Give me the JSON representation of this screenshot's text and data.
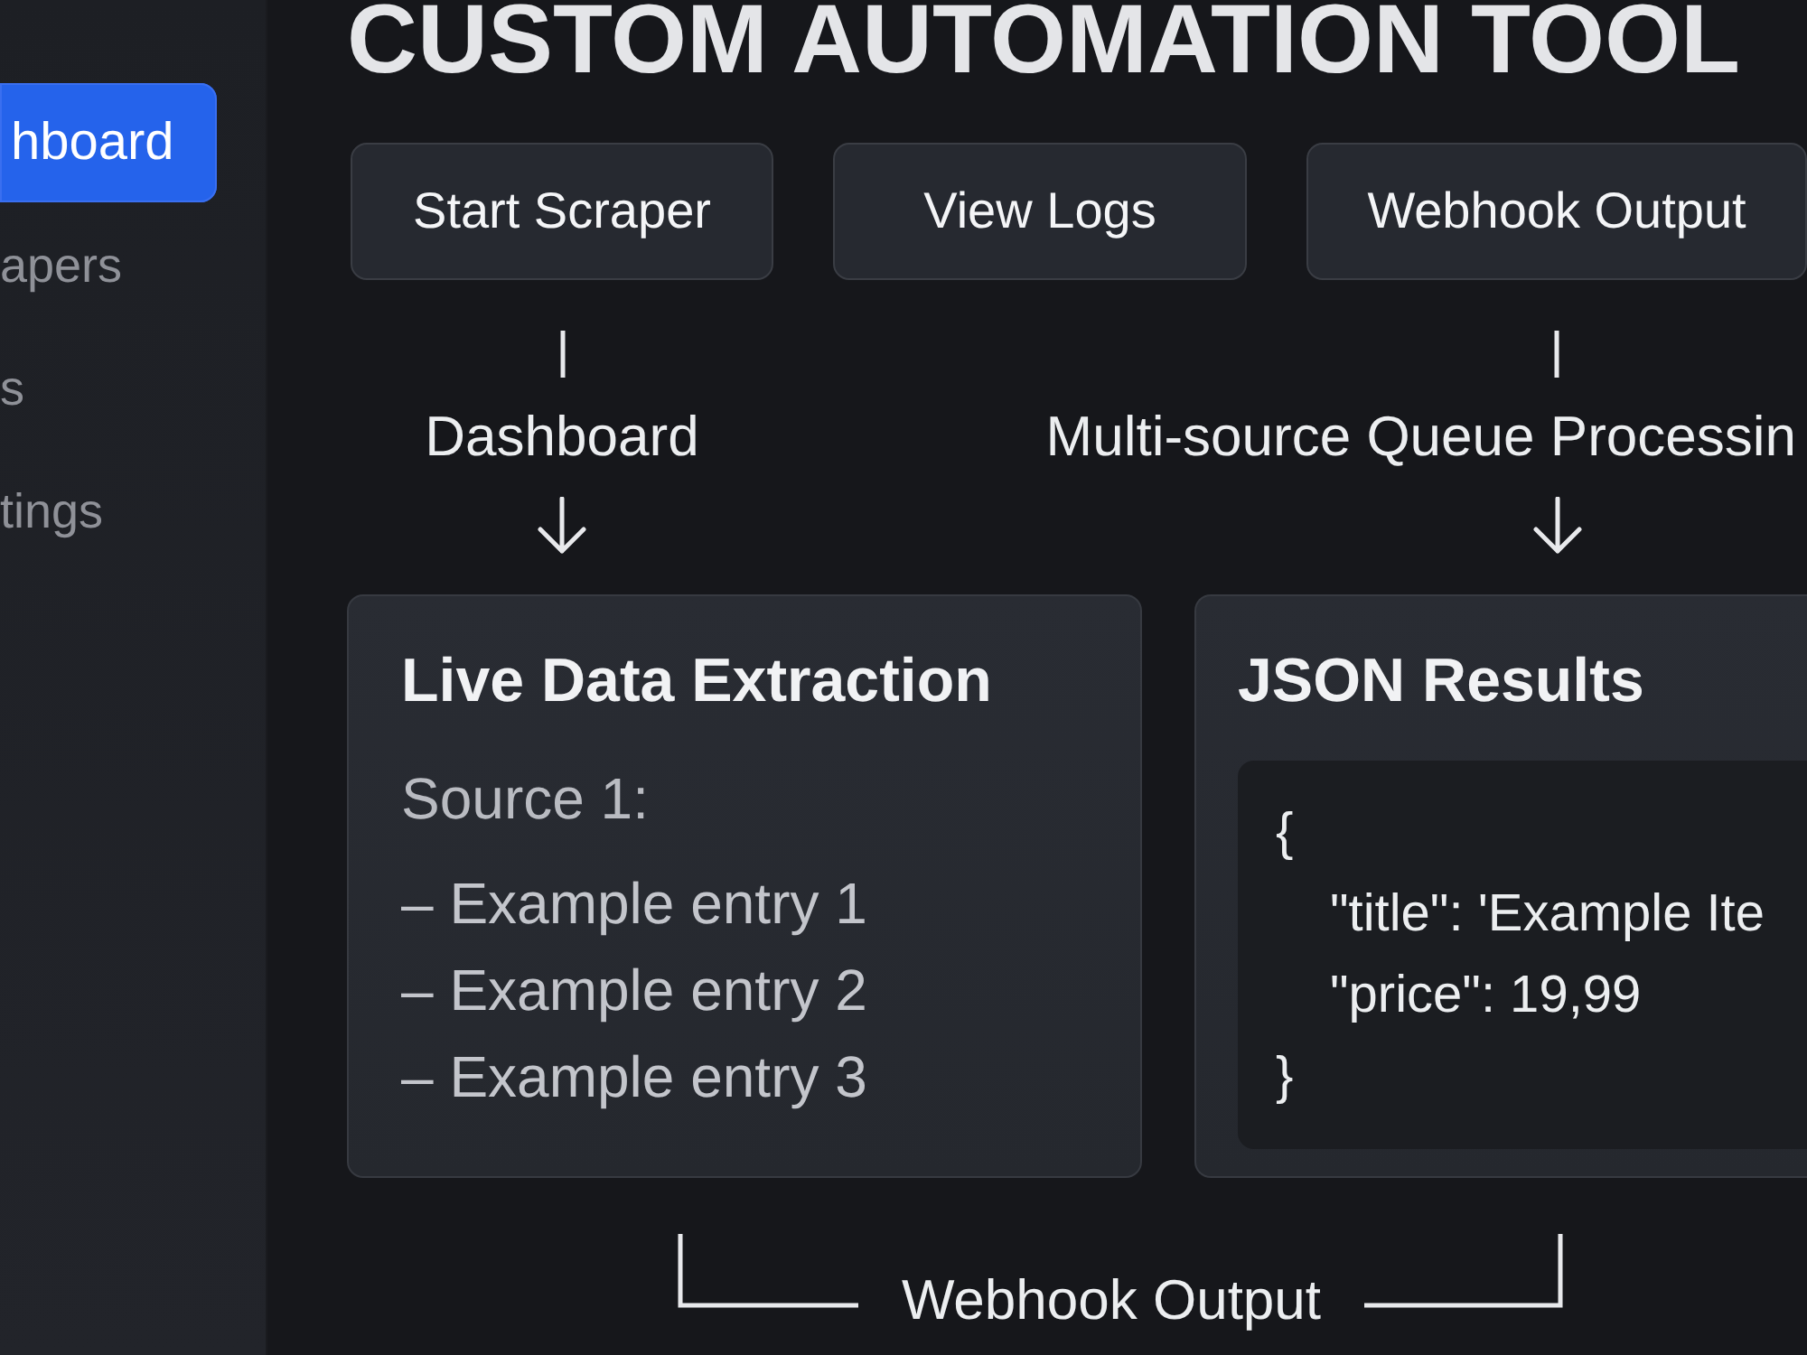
{
  "title": "CUSTOM AUTOMATION TOOL",
  "sidebar": {
    "items": [
      {
        "label": "hboard",
        "selected": true
      },
      {
        "label": "apers",
        "selected": false
      },
      {
        "label": "s",
        "selected": false
      },
      {
        "label": "tings",
        "selected": false
      }
    ]
  },
  "actions": [
    "Start Scraper",
    "View Logs",
    "Webhook Output"
  ],
  "flow_labels": [
    "Dashboard",
    "Multi-source Queue Processin"
  ],
  "cards": [
    {
      "kind": "list",
      "title": "Live Data Extraction",
      "subtitle": "Source 1:",
      "entries": [
        "– Example entry 1",
        "– Example entry 2",
        "– Example entry 3"
      ]
    },
    {
      "kind": "code",
      "title": "JSON Results",
      "code": {
        "open": "{",
        "fields": [
          "\"title\": 'Example Ite",
          "\"price\": 19,99"
        ],
        "close": "}"
      }
    }
  ],
  "footer_label": "Webhook Output"
}
